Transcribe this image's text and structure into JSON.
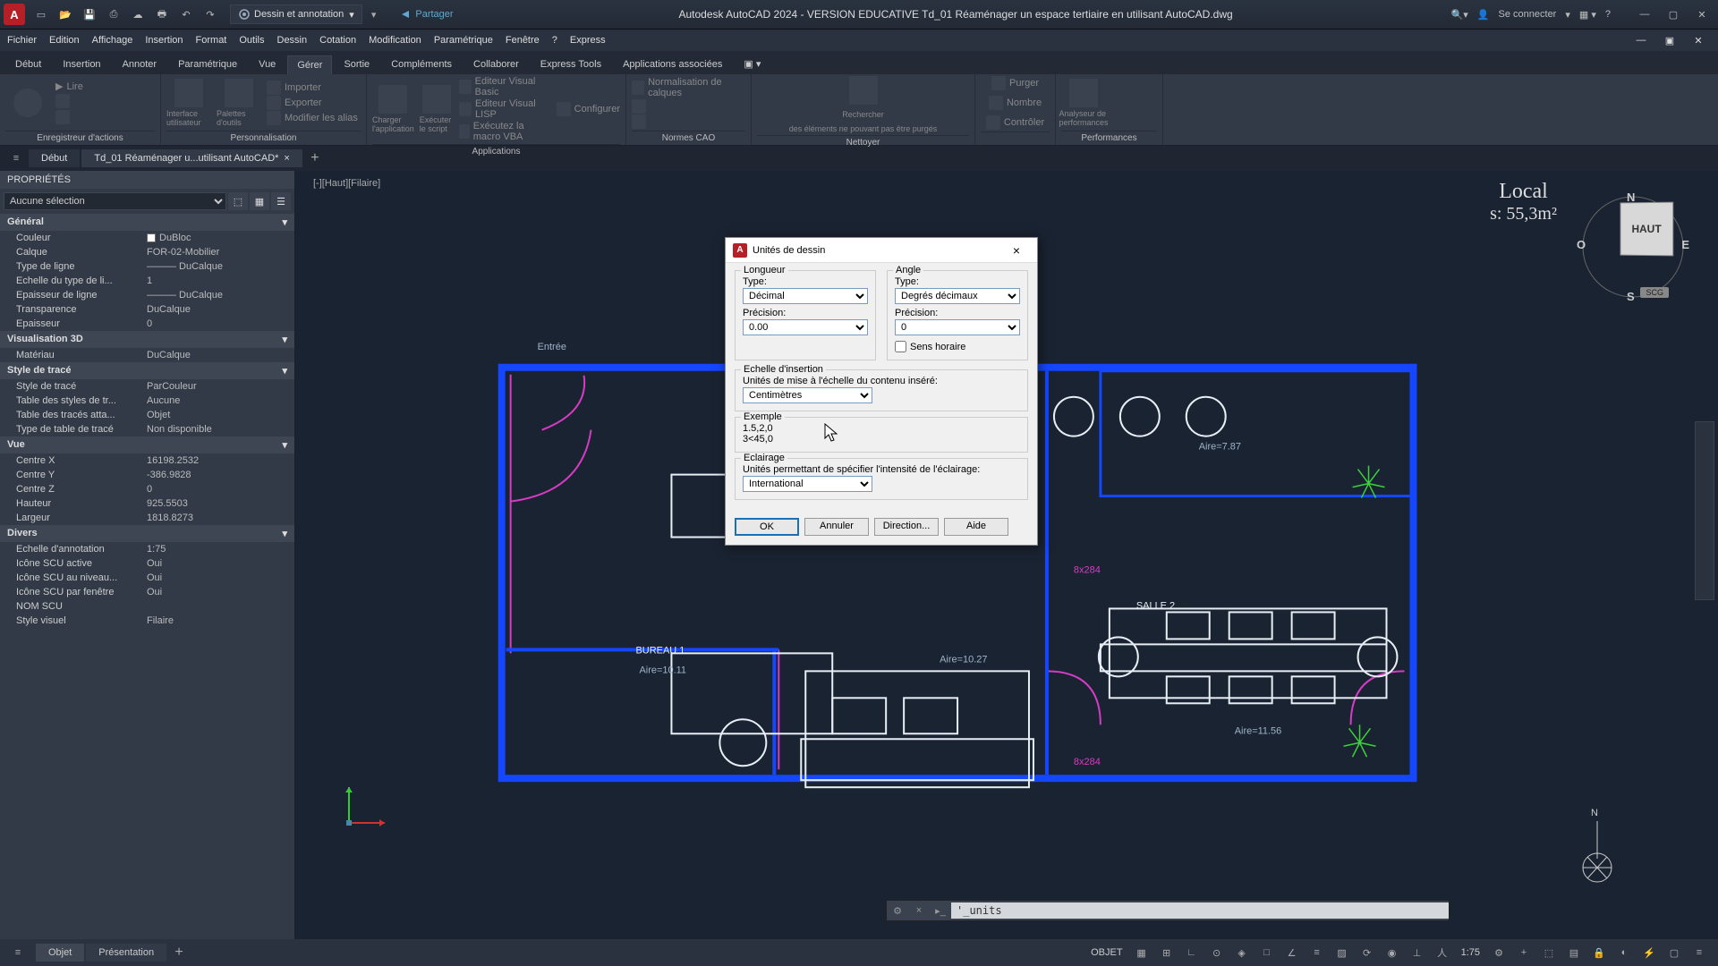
{
  "titlebar": {
    "app_letter": "A",
    "workspace": "Dessin et annotation",
    "share": "Partager",
    "title": "Autodesk AutoCAD 2024 - VERSION EDUCATIVE    Td_01 Réaménager un espace tertiaire en utilisant AutoCAD.dwg",
    "search_hint": "",
    "login": "Se connecter"
  },
  "menubar": [
    "Fichier",
    "Edition",
    "Affichage",
    "Insertion",
    "Format",
    "Outils",
    "Dessin",
    "Cotation",
    "Modification",
    "Paramétrique",
    "Fenêtre",
    "?",
    "Express"
  ],
  "ribbon": {
    "tabs": [
      "Début",
      "Insertion",
      "Annoter",
      "Paramétrique",
      "Vue",
      "Gérer",
      "Sortie",
      "Compléments",
      "Collaborer",
      "Express Tools",
      "Applications associées"
    ],
    "active_tab": "Gérer",
    "panels": [
      {
        "title": "Enregistreur d'actions",
        "items": [
          "Lire"
        ]
      },
      {
        "title": "Personnalisation",
        "items": [
          "Interface utilisateur",
          "Palettes d'outils",
          "Importer",
          "Exporter",
          "Modifier les alias"
        ]
      },
      {
        "title": "Applications",
        "items": [
          "Charger l'application",
          "Exécuter le script",
          "Editeur Visual Basic",
          "Editeur Visual LISP",
          "Exécutez la macro VBA",
          "Configurer"
        ]
      },
      {
        "title": "Normes CAO",
        "items": [
          "Normalisation de calques"
        ]
      },
      {
        "title": "Nettoyer",
        "items": [
          "Rechercher",
          "des éléments ne pouvant pas être purgés"
        ]
      },
      {
        "title": "",
        "items": [
          "Purger",
          "Nombre",
          "Contrôler"
        ]
      },
      {
        "title": "Performances",
        "items": [
          "Analyseur de performances"
        ]
      }
    ]
  },
  "doc_tabs": {
    "tabs": [
      "Début",
      "Td_01 Réaménager u...utilisant AutoCAD*"
    ],
    "active": 1
  },
  "properties": {
    "header": "PROPRIÉTÉS",
    "selection": "Aucune sélection",
    "groups": [
      {
        "name": "Général",
        "rows": [
          {
            "label": "Couleur",
            "value": "DuBloc",
            "swatch": "#fff"
          },
          {
            "label": "Calque",
            "value": "FOR-02-Mobilier"
          },
          {
            "label": "Type de ligne",
            "value": "——— DuCalque"
          },
          {
            "label": "Echelle du type de li...",
            "value": "1"
          },
          {
            "label": "Epaisseur de ligne",
            "value": "——— DuCalque"
          },
          {
            "label": "Transparence",
            "value": "DuCalque"
          },
          {
            "label": "Epaisseur",
            "value": "0"
          }
        ]
      },
      {
        "name": "Visualisation 3D",
        "rows": [
          {
            "label": "Matériau",
            "value": "DuCalque"
          }
        ]
      },
      {
        "name": "Style de tracé",
        "rows": [
          {
            "label": "Style de tracé",
            "value": "ParCouleur"
          },
          {
            "label": "Table des styles de tr...",
            "value": "Aucune"
          },
          {
            "label": "Table des tracés atta...",
            "value": "Objet"
          },
          {
            "label": "Type de table de tracé",
            "value": "Non disponible"
          }
        ]
      },
      {
        "name": "Vue",
        "rows": [
          {
            "label": "Centre X",
            "value": "16198.2532"
          },
          {
            "label": "Centre Y",
            "value": "-386.9828"
          },
          {
            "label": "Centre Z",
            "value": "0"
          },
          {
            "label": "Hauteur",
            "value": "925.5503"
          },
          {
            "label": "Largeur",
            "value": "1818.8273"
          }
        ]
      },
      {
        "name": "Divers",
        "rows": [
          {
            "label": "Echelle d'annotation",
            "value": "1:75"
          },
          {
            "label": "Icône SCU active",
            "value": "Oui"
          },
          {
            "label": "Icône SCU au niveau...",
            "value": "Oui"
          },
          {
            "label": "Icône SCU par fenêtre",
            "value": "Oui"
          },
          {
            "label": "NOM SCU",
            "value": ""
          },
          {
            "label": "Style visuel",
            "value": "Filaire"
          }
        ]
      }
    ]
  },
  "viewport": {
    "label": "[-][Haut][Filaire]",
    "room": {
      "name": "Local",
      "area": "s: 55,3m²"
    },
    "viewcube": "HAUT",
    "compass": {
      "n": "N",
      "s": "S",
      "e": "E",
      "o": "O"
    },
    "scg": "SCG",
    "annotations": {
      "entree": "Entrée",
      "bureau1": "BUREAU 1",
      "bureau1_area": "Aire=10.11",
      "salle2": "SALLE 2",
      "aire787": "Aire=7.87",
      "aire1027": "Aire=10.27",
      "aire1156": "Aire=11.56",
      "touche1": "8x284",
      "touche2": "8x284"
    },
    "north": "N"
  },
  "dialog": {
    "title": "Unités de dessin",
    "length_grp": "Longueur",
    "angle_grp": "Angle",
    "type_lbl": "Type:",
    "precision_lbl": "Précision:",
    "length_type": "Décimal",
    "length_prec": "0.00",
    "angle_type": "Degrés décimaux",
    "angle_prec": "0",
    "clockwise": "Sens horaire",
    "scale_grp": "Echelle d'insertion",
    "scale_lbl": "Unités de mise à l'échelle du contenu inséré:",
    "scale_val": "Centimètres",
    "example_grp": "Exemple",
    "example_l1": "1.5,2,0",
    "example_l2": "3<45,0",
    "light_grp": "Eclairage",
    "light_lbl": "Unités permettant de spécifier l'intensité de l'éclairage:",
    "light_val": "International",
    "btn_ok": "OK",
    "btn_cancel": "Annuler",
    "btn_dir": "Direction...",
    "btn_help": "Aide"
  },
  "cmdline": {
    "value": "'_units"
  },
  "statusbar": {
    "tabs": [
      "Objet",
      "Présentation"
    ],
    "active": 0,
    "scale": "1:75",
    "objet_btn": "OBJET"
  }
}
